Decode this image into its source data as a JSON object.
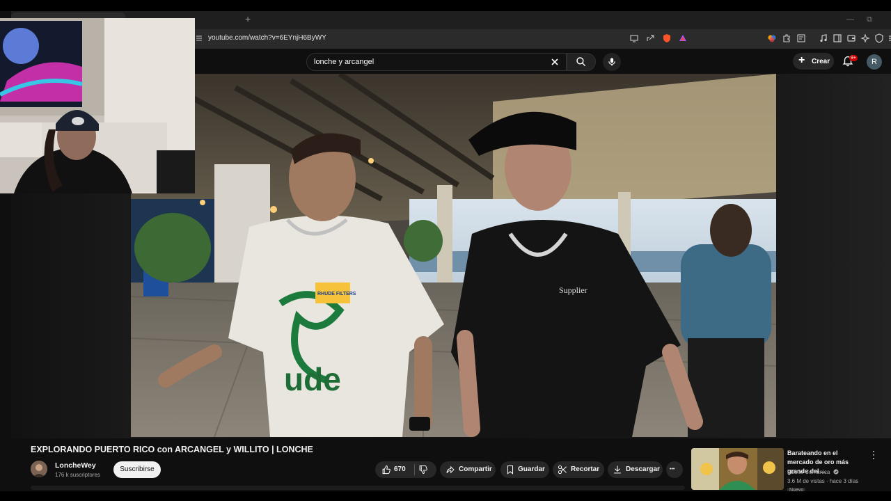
{
  "browser": {
    "new_tab_symbol": "+",
    "url": "youtube.com/watch?v=6EYnjH6ByWY",
    "window_controls": [
      "—",
      "⧉"
    ]
  },
  "header": {
    "search_query": "lonche y arcangel",
    "create_label": "Crear",
    "notification_count": "9+",
    "avatar_letter": "R"
  },
  "video": {
    "shirt_text_left": "ude",
    "shirt_text_right": "Supplier",
    "patch_text": "RHUDE FILTERS"
  },
  "meta": {
    "title": "EXPLORANDO PUERTO RICO con ARCANGEL y WILLITO | LONCHE",
    "channel_name": "LoncheWey",
    "subscribers": "176 k suscriptores",
    "subscribe_label": "Suscribirse",
    "likes": "670",
    "share_label": "Compartir",
    "save_label": "Guardar",
    "clip_label": "Recortar",
    "download_label": "Descargar",
    "more_symbol": "•••"
  },
  "suggestion": {
    "title": "Barateando en el mercado de oro más grande del ...",
    "channel": "Luisito Comunica",
    "meta": "3.6 M de vistas · hace 3 días",
    "badge": "Nuevo",
    "more_symbol": "⋮"
  },
  "colors": {
    "accent_red": "#cc0000",
    "background": "#0f0f0f",
    "pill": "#272727"
  }
}
